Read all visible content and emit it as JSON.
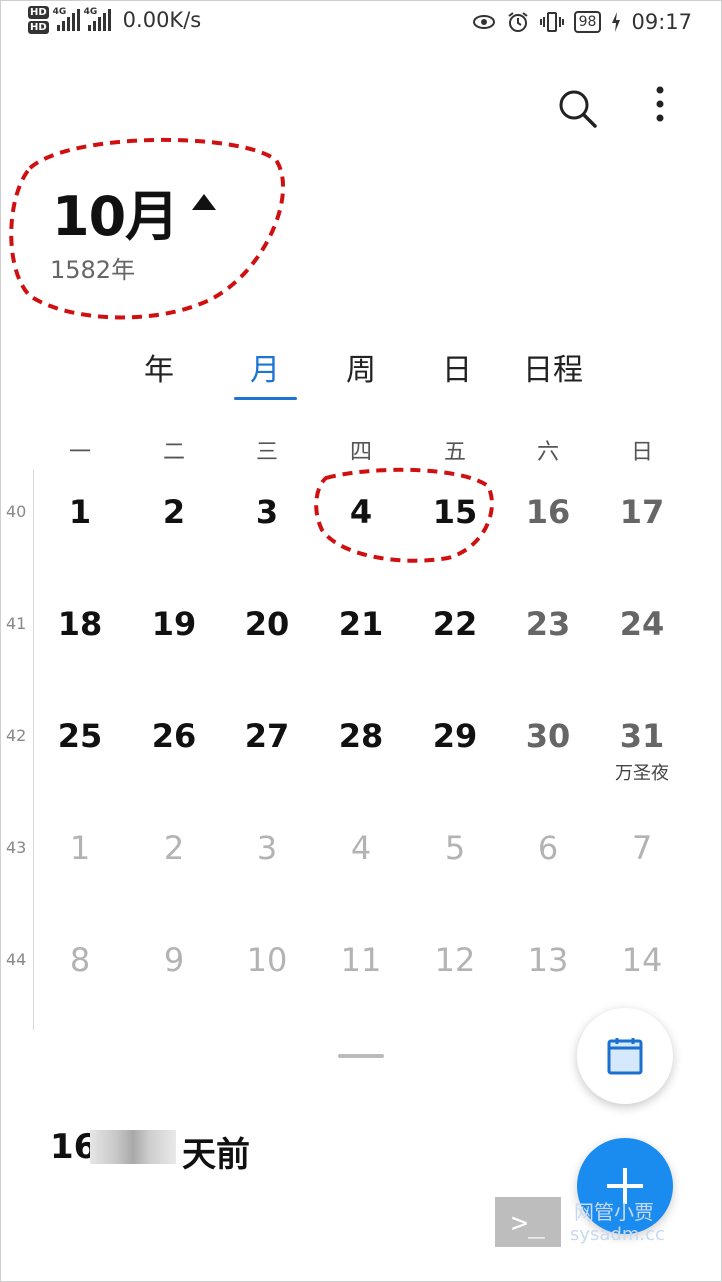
{
  "status_bar": {
    "hd1": "HD",
    "hd2": "HD",
    "net1": "4G",
    "net2": "4G",
    "net_speed": "0.00K/s",
    "battery": "98",
    "time": "09:17"
  },
  "header": {
    "month": "10月",
    "year": "1582年"
  },
  "tabs": [
    {
      "label": "年",
      "active": false
    },
    {
      "label": "月",
      "active": true
    },
    {
      "label": "周",
      "active": false
    },
    {
      "label": "日",
      "active": false
    },
    {
      "label": "日程",
      "active": false
    }
  ],
  "weekdays": [
    "一",
    "二",
    "三",
    "四",
    "五",
    "六",
    "日"
  ],
  "weeks": [
    {
      "num": "40",
      "days": [
        {
          "d": "1",
          "kind": "cur"
        },
        {
          "d": "2",
          "kind": "cur"
        },
        {
          "d": "3",
          "kind": "cur"
        },
        {
          "d": "4",
          "kind": "cur"
        },
        {
          "d": "15",
          "kind": "cur"
        },
        {
          "d": "16",
          "kind": "weekend"
        },
        {
          "d": "17",
          "kind": "weekend"
        }
      ]
    },
    {
      "num": "41",
      "days": [
        {
          "d": "18",
          "kind": "cur"
        },
        {
          "d": "19",
          "kind": "cur"
        },
        {
          "d": "20",
          "kind": "cur"
        },
        {
          "d": "21",
          "kind": "cur"
        },
        {
          "d": "22",
          "kind": "cur"
        },
        {
          "d": "23",
          "kind": "weekend"
        },
        {
          "d": "24",
          "kind": "weekend"
        }
      ]
    },
    {
      "num": "42",
      "days": [
        {
          "d": "25",
          "kind": "cur"
        },
        {
          "d": "26",
          "kind": "cur"
        },
        {
          "d": "27",
          "kind": "cur"
        },
        {
          "d": "28",
          "kind": "cur"
        },
        {
          "d": "29",
          "kind": "cur"
        },
        {
          "d": "30",
          "kind": "weekend"
        },
        {
          "d": "31",
          "kind": "weekend",
          "note": "万圣夜"
        }
      ]
    },
    {
      "num": "43",
      "days": [
        {
          "d": "1",
          "kind": "other"
        },
        {
          "d": "2",
          "kind": "other"
        },
        {
          "d": "3",
          "kind": "other"
        },
        {
          "d": "4",
          "kind": "other"
        },
        {
          "d": "5",
          "kind": "other"
        },
        {
          "d": "6",
          "kind": "other"
        },
        {
          "d": "7",
          "kind": "other"
        }
      ]
    },
    {
      "num": "44",
      "days": [
        {
          "d": "8",
          "kind": "other"
        },
        {
          "d": "9",
          "kind": "other"
        },
        {
          "d": "10",
          "kind": "other"
        },
        {
          "d": "11",
          "kind": "other"
        },
        {
          "d": "12",
          "kind": "other"
        },
        {
          "d": "13",
          "kind": "other"
        },
        {
          "d": "14",
          "kind": "other"
        }
      ]
    }
  ],
  "info": {
    "prefix": "16",
    "suffix": "天前"
  },
  "watermark": {
    "prompt": ">_",
    "cn": "网管小贾",
    "url": "sysadm.cc"
  },
  "colors": {
    "accent": "#1e74d6",
    "fab": "#1a8cf0",
    "annotation": "#d01010"
  },
  "icons": {
    "search": "search-icon",
    "more": "more-vertical-icon",
    "today": "calendar-today-icon",
    "add": "add-icon"
  }
}
